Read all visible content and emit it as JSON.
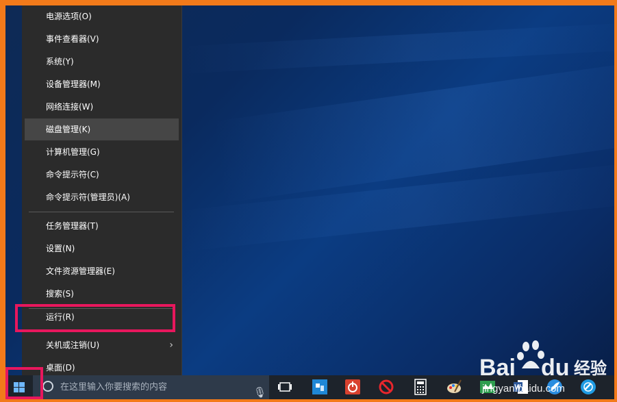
{
  "menu": {
    "items": [
      {
        "label": "电源选项(O)",
        "hover": false,
        "submenu": false
      },
      {
        "label": "事件查看器(V)",
        "hover": false,
        "submenu": false
      },
      {
        "label": "系统(Y)",
        "hover": false,
        "submenu": false
      },
      {
        "label": "设备管理器(M)",
        "hover": false,
        "submenu": false
      },
      {
        "label": "网络连接(W)",
        "hover": false,
        "submenu": false
      },
      {
        "label": "磁盘管理(K)",
        "hover": true,
        "submenu": false
      },
      {
        "label": "计算机管理(G)",
        "hover": false,
        "submenu": false
      },
      {
        "label": "命令提示符(C)",
        "hover": false,
        "submenu": false
      },
      {
        "label": "命令提示符(管理员)(A)",
        "hover": false,
        "submenu": false
      },
      {
        "label": "任务管理器(T)",
        "hover": false,
        "submenu": false
      },
      {
        "label": "设置(N)",
        "hover": false,
        "submenu": false
      },
      {
        "label": "文件资源管理器(E)",
        "hover": false,
        "submenu": false
      },
      {
        "label": "搜索(S)",
        "hover": false,
        "submenu": false
      },
      {
        "label": "运行(R)",
        "hover": false,
        "submenu": false
      },
      {
        "label": "关机或注销(U)",
        "hover": false,
        "submenu": true
      },
      {
        "label": "桌面(D)",
        "hover": false,
        "submenu": false
      }
    ]
  },
  "taskbar": {
    "search_placeholder": "在这里输入你要搜索的内容",
    "icons": [
      "task-view-icon",
      "qq-browser-icon",
      "power-app-icon",
      "no-entry-icon",
      "calculator-icon",
      "paint-icon",
      "green-app-icon",
      "word-icon",
      "feather-app-icon",
      "circle-app-icon"
    ]
  },
  "watermark": {
    "brand": "Bai",
    "brand_suffix": "du",
    "cn": "经验",
    "url": "jingyan.baidu.com"
  },
  "colors": {
    "frame": "#f27a1a",
    "highlight": "#e8175d",
    "menu_bg": "#2b2b2b",
    "menu_hover": "#464646",
    "taskbar": "#1d232b"
  }
}
